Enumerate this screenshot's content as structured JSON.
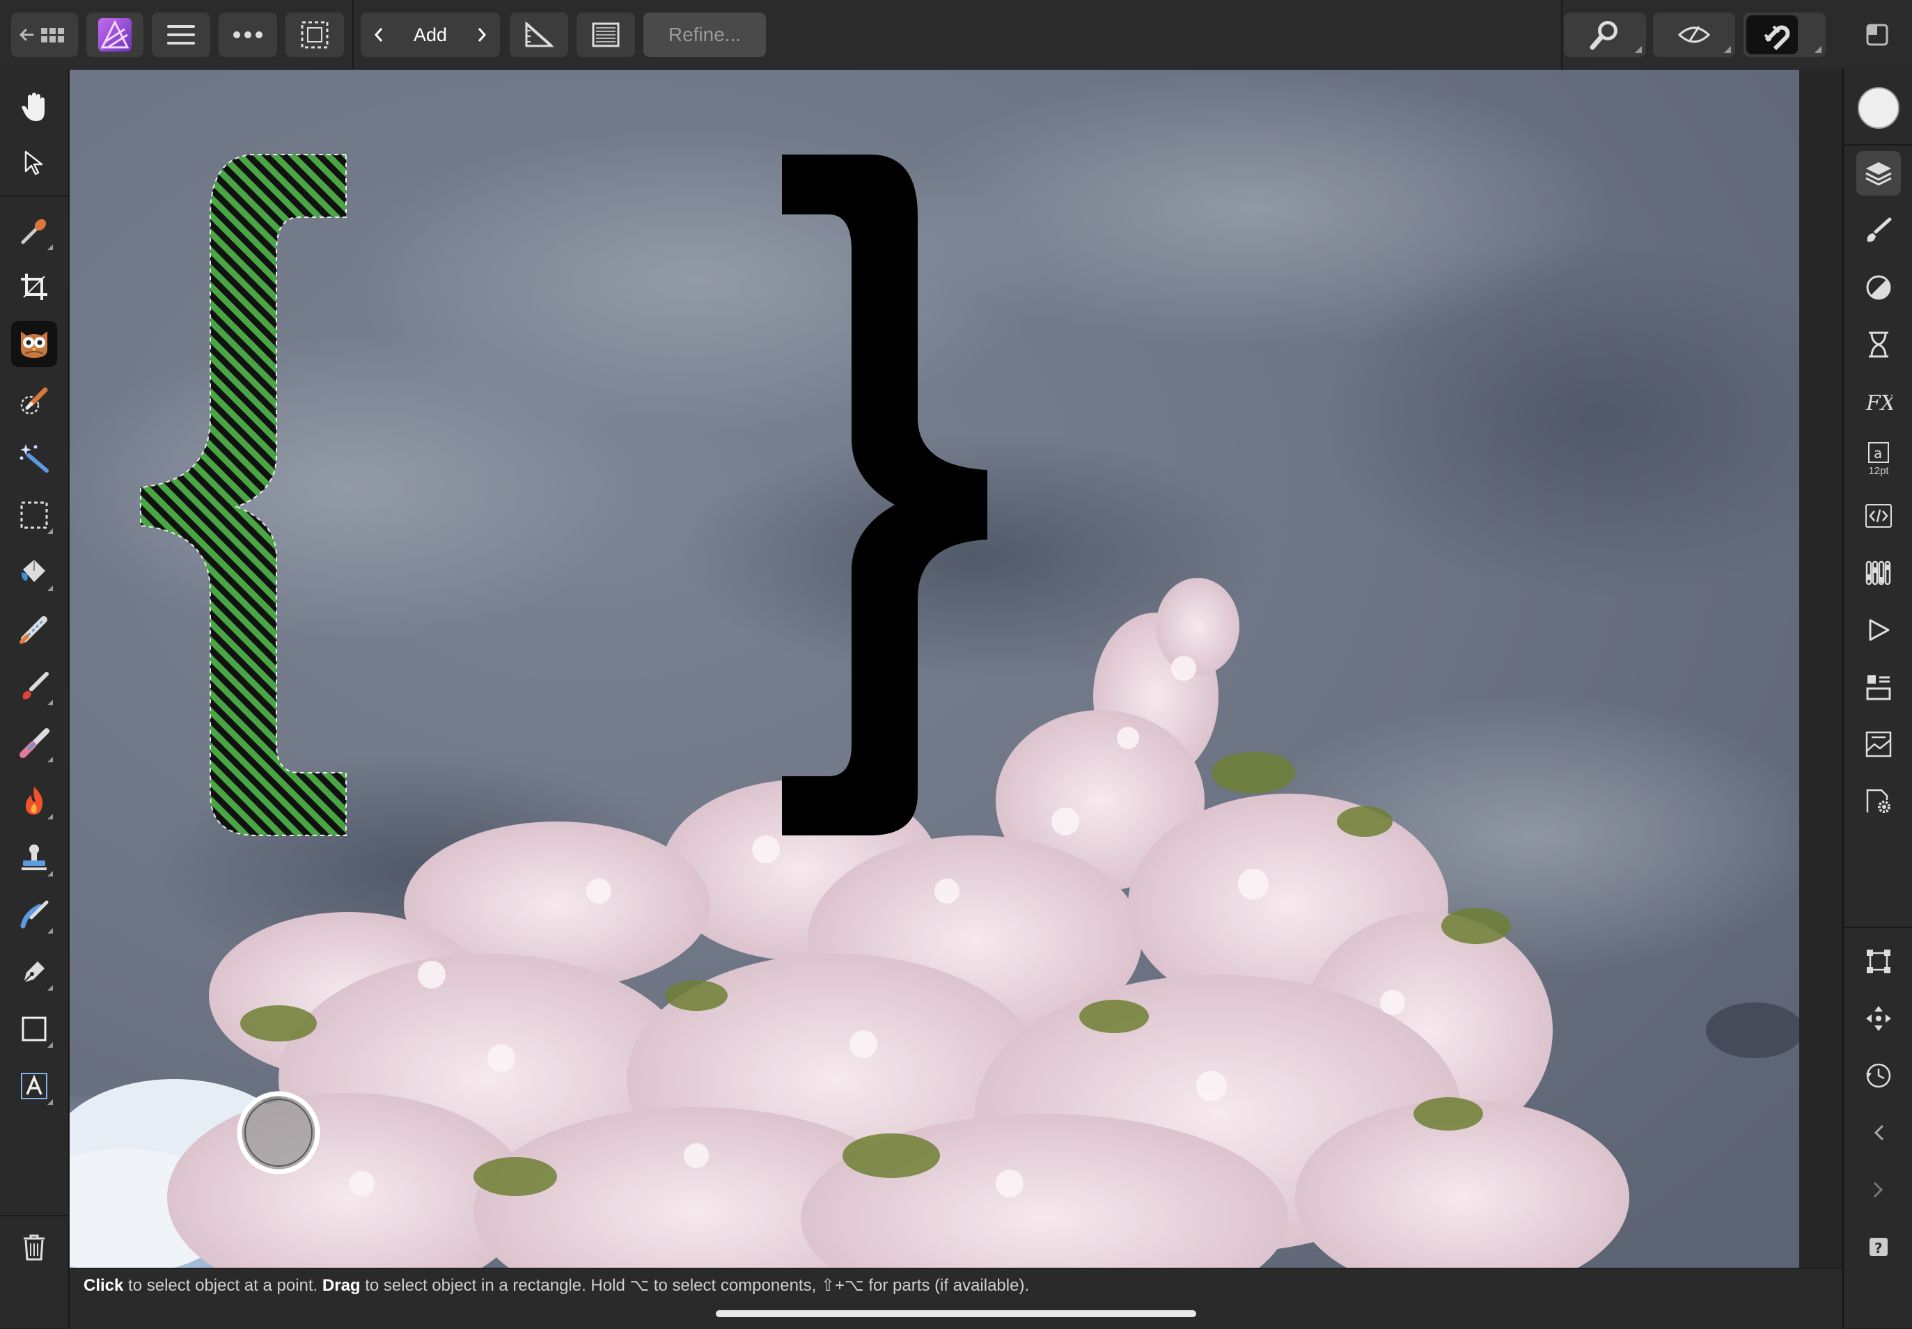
{
  "toolbar": {
    "mode_label": "Add",
    "refine_label": "Refine..."
  },
  "status": {
    "w1": "Click",
    "t1": " to select object at a point. ",
    "w2": "Drag",
    "t2": " to select object in a rectangle. Hold ⌥ to select components, ⇧+⌥ for parts (if available)."
  },
  "right_panel": {
    "character_size": "12pt"
  },
  "colors": {
    "app_accent": "#9b59d6",
    "selection_green": "#3f9e3f",
    "canvas_sky": "#6e7584"
  },
  "icons": {
    "left_tools": [
      "hand-icon",
      "move-arrow-icon",
      "eyedropper-icon",
      "crop-icon",
      "owl-icon",
      "selection-brush-icon",
      "magic-wand-icon",
      "marquee-icon",
      "flood-fill-icon",
      "paint-mixer-icon",
      "paint-brush-icon",
      "erase-brush-icon",
      "burn-icon",
      "clone-stamp-icon",
      "smudge-icon",
      "pen-icon",
      "rectangle-icon",
      "text-icon",
      "trash-icon"
    ],
    "right_panel": [
      "color-swatch-icon",
      "layers-icon",
      "brushes-icon",
      "adjustments-icon",
      "history-icon",
      "fx-icon",
      "character-icon",
      "code-icon",
      "channels-icon",
      "play-icon",
      "styles-icon",
      "navigator-icon",
      "settings-icon",
      "transform-icon",
      "move-icon",
      "clock-icon",
      "chevron-left-icon",
      "chevron-right-icon",
      "help-icon"
    ]
  }
}
